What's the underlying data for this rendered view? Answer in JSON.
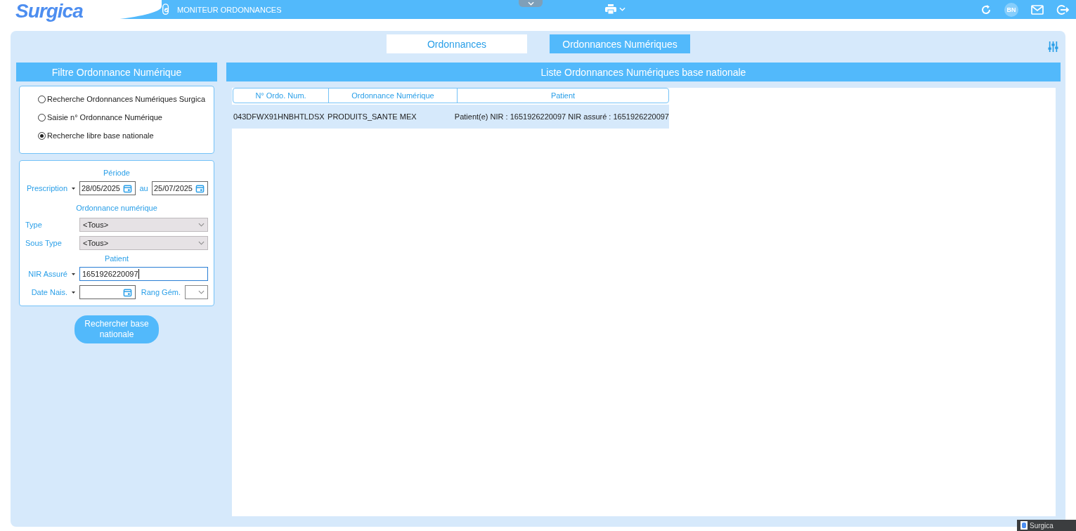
{
  "header": {
    "logo": "Surgica",
    "module_title": "MONITEUR ORDONNANCES",
    "user_initials": "BN"
  },
  "tabs": [
    {
      "label": "Ordonnances",
      "selected": false
    },
    {
      "label": "Ordonnances Numériques",
      "selected": true
    }
  ],
  "filter_panel": {
    "title": "Filtre Ordonnance Numérique",
    "search_modes": [
      {
        "label": "Recherche Ordonnances Numériques Surgica",
        "selected": false
      },
      {
        "label": "Saisie n° Ordonnance Numérique",
        "selected": false
      },
      {
        "label": "Recherche libre base nationale",
        "selected": true
      }
    ],
    "period": {
      "heading": "Période",
      "date_kind": "Prescription",
      "from": "28/05/2025",
      "separator": "au",
      "to": "25/07/2025"
    },
    "prescription": {
      "heading": "Ordonnance numérique",
      "fields": [
        {
          "label": "Type",
          "value": "<Tous>"
        },
        {
          "label": "Sous Type",
          "value": "<Tous>"
        }
      ]
    },
    "patient": {
      "heading": "Patient",
      "nir_label": "NIR Assuré",
      "nir_value": "1651926220097",
      "birth_label": "Date Nais.",
      "rank_label": "Rang Gém."
    },
    "search_button": "Rechercher base nationale"
  },
  "results": {
    "title": "Liste Ordonnances Numériques base nationale",
    "columns": [
      "N° Ordo. Num.",
      "Ordonnance Numérique",
      "Patient"
    ],
    "rows": [
      {
        "cells": [
          "043DFWX91HNBHTLDSX",
          "PRODUITS_SANTE MEX",
          "Patient(e) NIR : 1651926220097 NIR assuré : 1651926220097"
        ],
        "selected": true
      }
    ]
  },
  "taskbar": {
    "label": "Surgica"
  }
}
